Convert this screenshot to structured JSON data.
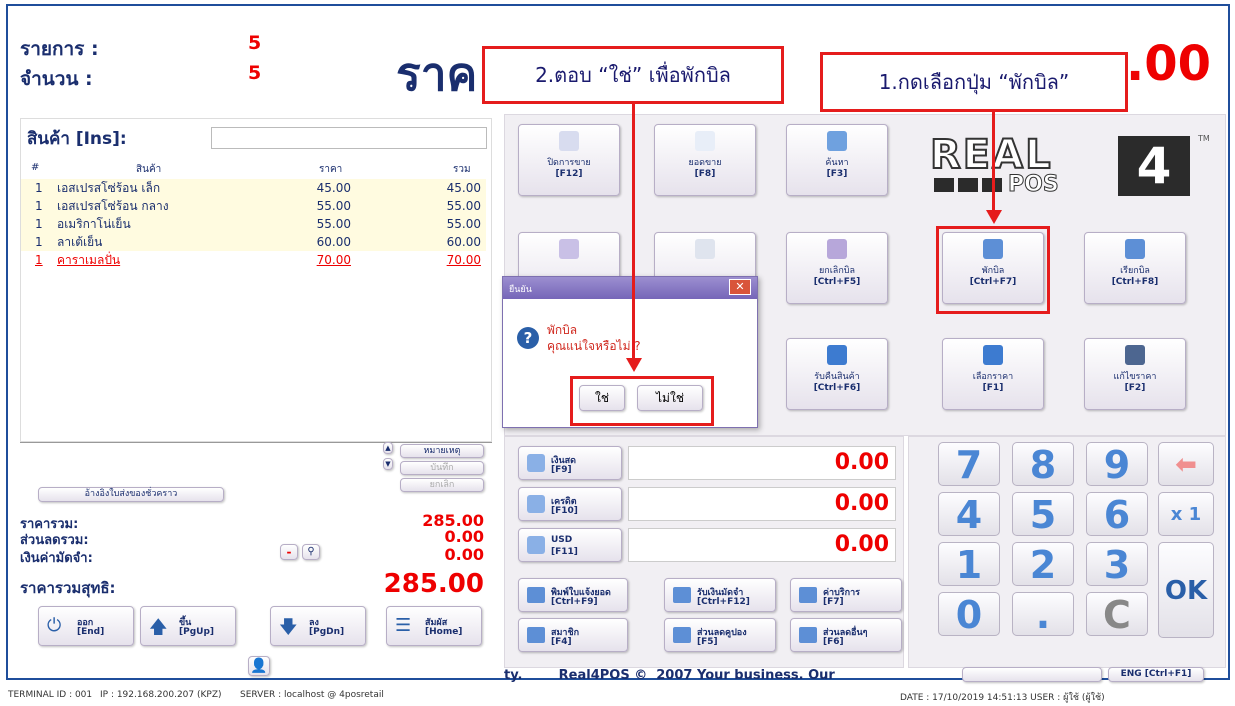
{
  "header": {
    "items_label": "รายการ :",
    "items_value": "5",
    "qty_label": "จำนวน :",
    "qty_value": "5",
    "price_label": "ราค",
    "total_partial": ".00"
  },
  "callouts": {
    "step1": "1.กดเลือกปุ่ม “พักบิล”",
    "step2": "2.ตอบ “ใช่” เพื่อพักบิล"
  },
  "product": {
    "label": "สินค้า [Ins]:",
    "input_value": "",
    "columns": [
      "#",
      "สินค้า",
      "ราคา",
      "รวม"
    ],
    "rows": [
      {
        "qty": "1",
        "name": "เอสเปรสโซ่ร้อน เล็ก",
        "price": "45.00",
        "total": "45.00"
      },
      {
        "qty": "1",
        "name": "เอสเปรสโซ่ร้อน กลาง",
        "price": "55.00",
        "total": "55.00"
      },
      {
        "qty": "1",
        "name": "อเมริกาโน่เย็น",
        "price": "55.00",
        "total": "55.00"
      },
      {
        "qty": "1",
        "name": "ลาเต้เย็น",
        "price": "60.00",
        "total": "60.00"
      },
      {
        "qty": "1",
        "name": "คาราเมลปั่น",
        "price": "70.00",
        "total": "70.00"
      }
    ]
  },
  "side_buttons": {
    "note": "หมายเหตุ",
    "save": "บันทึก",
    "cancel": "ยกเลิก"
  },
  "ref_button": "อ้างอิงใบส่งของชั่วคราว",
  "summary": {
    "subtotal_label": "ราคารวม:",
    "subtotal": "285.00",
    "discount_label": "ส่วนลดรวม:",
    "discount": "0.00",
    "deposit_label": "เงินค่ามัดจำ:",
    "deposit": "0.00",
    "net_label": "ราคารวมสุทธิ:",
    "net": "285.00",
    "minus": "-"
  },
  "bottom_nav": [
    {
      "label": "ออก",
      "key": "[End]"
    },
    {
      "label": "ขึ้น",
      "key": "[PgUp]"
    },
    {
      "label": "ลง",
      "key": "[PgDn]"
    },
    {
      "label": "สัมผัส",
      "key": "[Home]"
    }
  ],
  "func_buttons": [
    {
      "label": "ปิดการขาย",
      "key": "[F12]"
    },
    {
      "label": "ยอดขาย",
      "key": "[F8]"
    },
    {
      "label": "ค้นหา",
      "key": "[F3]"
    },
    {
      "label": "",
      "key": ""
    },
    {
      "label": "",
      "key": ""
    },
    {
      "label": "ยกเลิกบิล",
      "key": "[Ctrl+F5]"
    },
    {
      "label": "พักบิล",
      "key": "[Ctrl+F7]"
    },
    {
      "label": "เรียกบิล",
      "key": "[Ctrl+F8]"
    },
    {
      "label": "รับคืนสินค้า",
      "key": "[Ctrl+F6]"
    },
    {
      "label": "เลือกราคา",
      "key": "[F1]"
    },
    {
      "label": "แก้ไขราคา",
      "key": "[F2]"
    }
  ],
  "logo": {
    "top": "REAL",
    "num": "4",
    "sub": "POS",
    "tm": "TM"
  },
  "payment": [
    {
      "label": "เงินสด",
      "key": "[F9]",
      "value": "0.00"
    },
    {
      "label": "เครดิต",
      "key": "[F10]",
      "value": "0.00"
    },
    {
      "label": "USD",
      "key": "[F11]",
      "value": "0.00"
    }
  ],
  "pay_actions": [
    {
      "label": "พิมพ์ใบแจ้งยอด",
      "key": "[Ctrl+F9]"
    },
    {
      "label": "รับเงินมัดจำ",
      "key": "[Ctrl+F12]"
    },
    {
      "label": "ค่าบริการ",
      "key": "[F7]"
    },
    {
      "label": "สมาชิก",
      "key": "[F4]"
    },
    {
      "label": "ส่วนลดคูปอง",
      "key": "[F5]"
    },
    {
      "label": "ส่วนลดอื่นๆ",
      "key": "[F6]"
    }
  ],
  "numpad": [
    "7",
    "8",
    "9",
    "4",
    "5",
    "6",
    "1",
    "2",
    "3",
    "0",
    ".",
    "C"
  ],
  "numpad_extra": {
    "times": "x 1",
    "ok": "OK"
  },
  "dialog": {
    "title": "ยืนยัน",
    "line1": "พักบิล",
    "line2": "คุณแน่ใจหรือไม่ ?",
    "yes": "ใช่",
    "no": "ไม่ใช่"
  },
  "marquee": "ty.        Real4POS ©  2007 Your business. Our",
  "lang_button": "ENG [Ctrl+F1]",
  "status": {
    "terminal": "TERMINAL ID : 001",
    "ip": "IP : 192.168.200.207 (KPZ)",
    "server": "SERVER : localhost @ 4posretail",
    "date": "DATE : 17/10/2019  14:51:13   USER : ผู้ใช้ (ผู้ใช้)"
  }
}
